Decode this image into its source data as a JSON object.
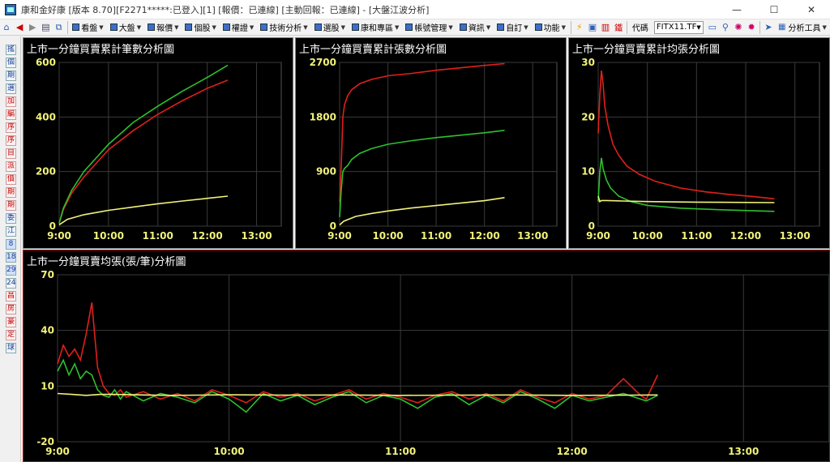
{
  "window": {
    "title": "康和金好康 [版本 8.70][F2271*****:已登入][1] [報價：已連線] [主動回報：已連線] - [大盤江波分析]",
    "minimize": "—",
    "maximize": "☐",
    "close": "✕"
  },
  "toolbar": {
    "menus": [
      {
        "label": "看盤",
        "icon": "chart-icon"
      },
      {
        "label": "大盤",
        "icon": "market-icon"
      },
      {
        "label": "報價",
        "icon": "quote-icon"
      },
      {
        "label": "個股",
        "icon": "stock-icon"
      },
      {
        "label": "權證",
        "icon": "warrant-icon"
      },
      {
        "label": "技術分析",
        "icon": "tech-icon"
      },
      {
        "label": "選股",
        "icon": "select-icon"
      },
      {
        "label": "康和專區",
        "icon": "zone-icon"
      },
      {
        "label": "帳號管理",
        "icon": "account-icon"
      },
      {
        "label": "資訊",
        "icon": "info-icon"
      },
      {
        "label": "自訂",
        "icon": "custom-icon"
      },
      {
        "label": "功能",
        "icon": "function-icon"
      }
    ],
    "code_label": "代碼",
    "ticker_value": "FITX11.TF",
    "analysis_tools": "分析工具"
  },
  "sidebar": {
    "items": [
      "搖",
      "個",
      "期",
      "選",
      "加",
      "編",
      "序",
      "序",
      "目",
      "派",
      "價",
      "期",
      "期",
      "委",
      "江",
      "8",
      "18",
      "29",
      "24",
      "昌",
      "房",
      "豪",
      "定",
      "球"
    ]
  },
  "colors": {
    "red": "#e0201b",
    "green": "#2ec02e",
    "yellow": "#f2f27a",
    "grid": "#3a3a3a",
    "axis_text": "#f2f27a",
    "background": "#000000"
  },
  "chart_data": [
    {
      "type": "line",
      "title": "上市一分鐘買賣累計筆數分析圖",
      "xticks": [
        "9:00",
        "10:00",
        "11:00",
        "12:00",
        "13:00"
      ],
      "ylim": [
        0,
        600
      ],
      "yticks": [
        "0",
        "200",
        "400",
        "600"
      ],
      "series": [
        {
          "color": "red",
          "x": [
            0,
            5,
            15,
            30,
            60,
            90,
            120,
            150,
            180,
            205
          ],
          "y": [
            10,
            60,
            120,
            180,
            280,
            350,
            410,
            460,
            505,
            535
          ]
        },
        {
          "color": "green",
          "x": [
            0,
            5,
            15,
            30,
            60,
            90,
            120,
            150,
            180,
            205
          ],
          "y": [
            10,
            65,
            130,
            200,
            300,
            380,
            440,
            495,
            545,
            590
          ]
        },
        {
          "color": "yellow",
          "x": [
            0,
            10,
            30,
            60,
            90,
            120,
            150,
            180,
            205
          ],
          "y": [
            5,
            25,
            42,
            58,
            70,
            82,
            92,
            102,
            110
          ]
        }
      ]
    },
    {
      "type": "line",
      "title": "上市一分鐘買賣累計張數分析圖",
      "xticks": [
        "9:00",
        "10:00",
        "11:00",
        "12:00",
        "13:00"
      ],
      "ylim": [
        0,
        2700
      ],
      "yticks": [
        "0",
        "900",
        "1800",
        "2700"
      ],
      "series": [
        {
          "color": "red",
          "x": [
            0,
            2,
            4,
            6,
            10,
            15,
            25,
            40,
            60,
            90,
            120,
            150,
            180,
            205
          ],
          "y": [
            400,
            1000,
            1800,
            2000,
            2150,
            2250,
            2350,
            2420,
            2480,
            2520,
            2570,
            2610,
            2650,
            2680
          ]
        },
        {
          "color": "green",
          "x": [
            0,
            2,
            4,
            6,
            10,
            15,
            25,
            40,
            60,
            90,
            120,
            150,
            180,
            205
          ],
          "y": [
            150,
            600,
            900,
            950,
            1000,
            1100,
            1200,
            1280,
            1350,
            1410,
            1460,
            1500,
            1540,
            1580
          ]
        },
        {
          "color": "yellow",
          "x": [
            0,
            5,
            20,
            40,
            60,
            90,
            120,
            150,
            180,
            205
          ],
          "y": [
            20,
            80,
            160,
            210,
            250,
            300,
            340,
            380,
            420,
            470
          ]
        }
      ]
    },
    {
      "type": "line",
      "title": "上市一分鐘買賣累計均張分析圖",
      "xticks": [
        "9:00",
        "10:00",
        "11:00",
        "12:00",
        "13:00"
      ],
      "ylim": [
        0,
        30
      ],
      "yticks": [
        "0",
        "10",
        "20",
        "30"
      ],
      "series": [
        {
          "color": "red",
          "x": [
            0,
            2,
            4,
            6,
            8,
            12,
            18,
            25,
            35,
            50,
            70,
            100,
            130,
            160,
            190,
            215
          ],
          "y": [
            17,
            24,
            28.5,
            26,
            22,
            18.5,
            15,
            13,
            11,
            9.5,
            8.2,
            7,
            6.3,
            5.8,
            5.4,
            5
          ]
        },
        {
          "color": "green",
          "x": [
            0,
            2,
            4,
            6,
            10,
            15,
            25,
            40,
            60,
            100,
            150,
            215
          ],
          "y": [
            4.5,
            10,
            12.5,
            10.5,
            8.5,
            7,
            5.5,
            4.5,
            3.8,
            3.3,
            3,
            2.7
          ]
        },
        {
          "color": "yellow",
          "x": [
            0,
            2,
            4,
            10,
            30,
            60,
            120,
            215
          ],
          "y": [
            5.5,
            4.5,
            4.7,
            4.7,
            4.6,
            4.5,
            4.4,
            4.3
          ]
        }
      ]
    },
    {
      "type": "line",
      "title": "上市一分鐘買賣均張(張/筆)分析圖",
      "xticks": [
        "9:00",
        "10:00",
        "11:00",
        "12:00",
        "13:00"
      ],
      "ylim": [
        -20,
        70
      ],
      "yticks": [
        "-20",
        "10",
        "40",
        "70"
      ],
      "series": [
        {
          "color": "red",
          "x": [
            0,
            2,
            4,
            6,
            8,
            10,
            12,
            14,
            16,
            18,
            20,
            22,
            24,
            30,
            36,
            42,
            48,
            54,
            60,
            66,
            72,
            78,
            84,
            90,
            96,
            102,
            108,
            114,
            120,
            126,
            132,
            138,
            144,
            150,
            156,
            162,
            168,
            174,
            180,
            186,
            192,
            198,
            204,
            206,
            210
          ],
          "y": [
            22,
            32,
            26,
            30,
            24,
            38,
            55,
            20,
            10,
            6,
            5,
            8,
            4,
            7,
            3,
            6,
            2,
            8,
            5,
            1,
            7,
            4,
            6,
            2,
            5,
            8,
            3,
            6,
            4,
            1,
            5,
            7,
            3,
            6,
            2,
            8,
            4,
            1,
            6,
            3,
            5,
            14,
            5,
            3,
            16
          ]
        },
        {
          "color": "green",
          "x": [
            0,
            2,
            4,
            6,
            8,
            10,
            12,
            14,
            16,
            18,
            20,
            22,
            24,
            30,
            36,
            42,
            48,
            54,
            60,
            66,
            72,
            78,
            84,
            90,
            96,
            102,
            108,
            114,
            120,
            126,
            132,
            138,
            144,
            150,
            156,
            162,
            168,
            174,
            180,
            186,
            192,
            198,
            204,
            206,
            210
          ],
          "y": [
            18,
            24,
            16,
            22,
            14,
            18,
            16,
            8,
            5,
            4,
            8,
            3,
            7,
            2,
            6,
            4,
            1,
            7,
            3,
            -4,
            6,
            2,
            5,
            0,
            4,
            7,
            1,
            5,
            3,
            -2,
            4,
            6,
            0,
            5,
            1,
            7,
            3,
            -2,
            5,
            2,
            4,
            6,
            3,
            2,
            5
          ]
        },
        {
          "color": "yellow",
          "x": [
            0,
            5,
            10,
            15,
            20,
            30,
            40,
            60,
            80,
            100,
            120,
            140,
            160,
            180,
            200,
            210
          ],
          "y": [
            6,
            5.5,
            5,
            5.5,
            5.5,
            5.2,
            5,
            5.3,
            5.1,
            5.2,
            5,
            5.1,
            5.2,
            5,
            5.1,
            5.2
          ]
        }
      ]
    }
  ]
}
